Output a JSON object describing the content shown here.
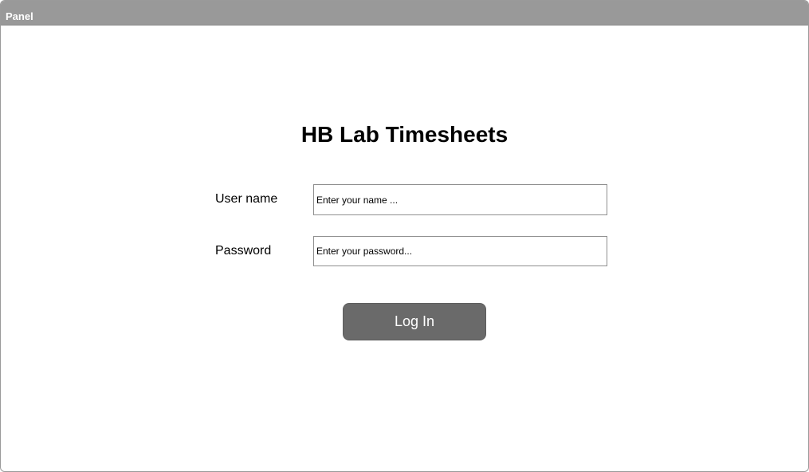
{
  "panel": {
    "title": "Panel"
  },
  "login": {
    "title": "HB Lab Timesheets",
    "username_label": "User name",
    "username_placeholder": "Enter your name ...",
    "username_value": "",
    "password_label": "Password",
    "password_placeholder": "Enter your password...",
    "password_value": "",
    "submit_label": "Log In"
  },
  "colors": {
    "header_bg": "#999999",
    "button_bg": "#6a6a6a",
    "button_text": "#ffffff"
  }
}
